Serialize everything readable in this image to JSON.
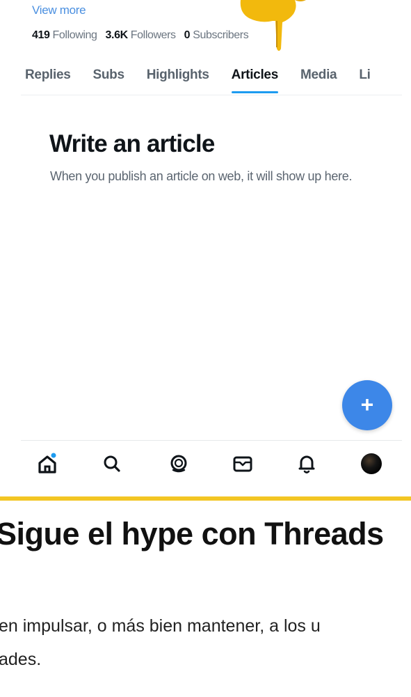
{
  "profile": {
    "view_more": "View more",
    "following_count": "419",
    "following_label": "Following",
    "followers_count": "3.6K",
    "followers_label": "Followers",
    "subscribers_count": "0",
    "subscribers_label": "Subscribers"
  },
  "tabs": [
    {
      "label": "Replies"
    },
    {
      "label": "Subs"
    },
    {
      "label": "Highlights"
    },
    {
      "label": "Articles",
      "active": true
    },
    {
      "label": "Media"
    },
    {
      "label": "Li"
    }
  ],
  "empty_state": {
    "title": "Write an article",
    "description": "When you publish an article on web, it will show up here."
  },
  "fab": {
    "icon": "plus-icon",
    "color": "#3d87e8"
  },
  "bottom_nav": [
    {
      "icon": "home-icon",
      "has_notification_dot": true
    },
    {
      "icon": "search-icon"
    },
    {
      "icon": "grok-icon"
    },
    {
      "icon": "messages-icon"
    },
    {
      "icon": "notifications-icon"
    },
    {
      "icon": "profile-avatar-icon"
    }
  ],
  "overlay": {
    "icon": "pointing-hand-emoji"
  },
  "article": {
    "accent_color": "#f3c623",
    "headline": "Sigue el hype con Threads",
    "body_line_1": "en impulsar, o más bien mantener, a los u",
    "body_line_2": "ades."
  }
}
